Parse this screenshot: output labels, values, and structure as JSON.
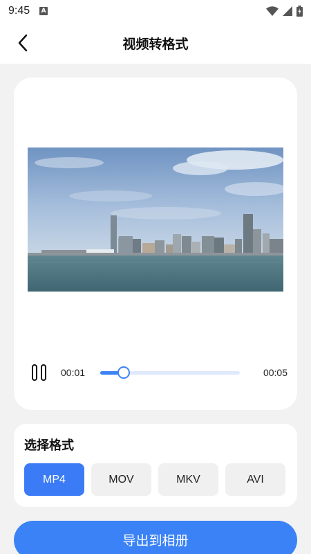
{
  "status_bar": {
    "time": "9:45",
    "notification_icon": "A"
  },
  "header": {
    "title": "视频转格式",
    "back_icon": "chevron-left-icon"
  },
  "player": {
    "current_time": "00:01",
    "total_time": "00:05",
    "progress": 0.17,
    "state": "playing",
    "colors": {
      "accent": "#3b82f6",
      "track": "#dfe9fb"
    }
  },
  "format_section": {
    "title": "选择格式",
    "options": [
      "MP4",
      "MOV",
      "MKV",
      "AVI"
    ],
    "selected": "MP4"
  },
  "export_button": {
    "label": "导出到相册"
  }
}
